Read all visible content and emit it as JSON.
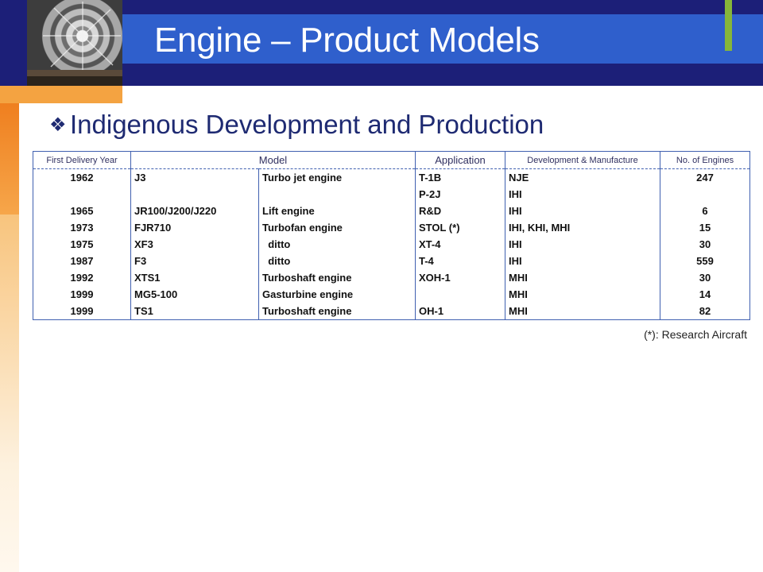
{
  "slide": {
    "title": "Engine – Product Models",
    "bullet": "Indigenous Development and Production",
    "footnote": "(*): Research Aircraft"
  },
  "table": {
    "headers": [
      "First Delivery Year",
      "Model",
      "Application",
      "Development & Manufacture",
      "No. of Engines"
    ],
    "rows": [
      {
        "year": "1962",
        "model": "J3",
        "type": "Turbo jet engine",
        "application": "T-1B",
        "maker": "NJE",
        "engines": "247"
      },
      {
        "year": "",
        "model": "",
        "type": "",
        "application": "P-2J",
        "maker": "IHI",
        "engines": ""
      },
      {
        "year": "1965",
        "model": "JR100/J200/J220",
        "type": "Lift engine",
        "application": "R&D",
        "maker": "IHI",
        "engines": "6"
      },
      {
        "year": "1973",
        "model": "FJR710",
        "type": "Turbofan engine",
        "application": "STOL (*)",
        "maker": "IHI, KHI, MHI",
        "engines": "15"
      },
      {
        "year": "1975",
        "model": "XF3",
        "type": "  ditto",
        "application": "XT-4",
        "maker": "IHI",
        "engines": "30"
      },
      {
        "year": "1987",
        "model": "F3",
        "type": "  ditto",
        "application": "T-4",
        "maker": "IHI",
        "engines": "559"
      },
      {
        "year": "1992",
        "model": "XTS1",
        "type": "Turboshaft engine",
        "application": "XOH-1",
        "maker": "MHI",
        "engines": "30"
      },
      {
        "year": "1999",
        "model": "MG5-100",
        "type": "Gasturbine engine",
        "application": "",
        "maker": "MHI",
        "engines": "14"
      },
      {
        "year": "1999",
        "model": "TS1",
        "type": "Turboshaft engine",
        "application": "OH-1",
        "maker": "MHI",
        "engines": "82"
      }
    ]
  },
  "icons": {
    "bullet": "diamond-bullet-icon",
    "header_image": "jet-engine-image"
  },
  "colors": {
    "header_dark": "#1c1f78",
    "header_blue": "#2f5fcc",
    "accent_green": "#86b63a",
    "accent_orange": "#ef7f1f",
    "text_navy": "#1e2a72"
  }
}
